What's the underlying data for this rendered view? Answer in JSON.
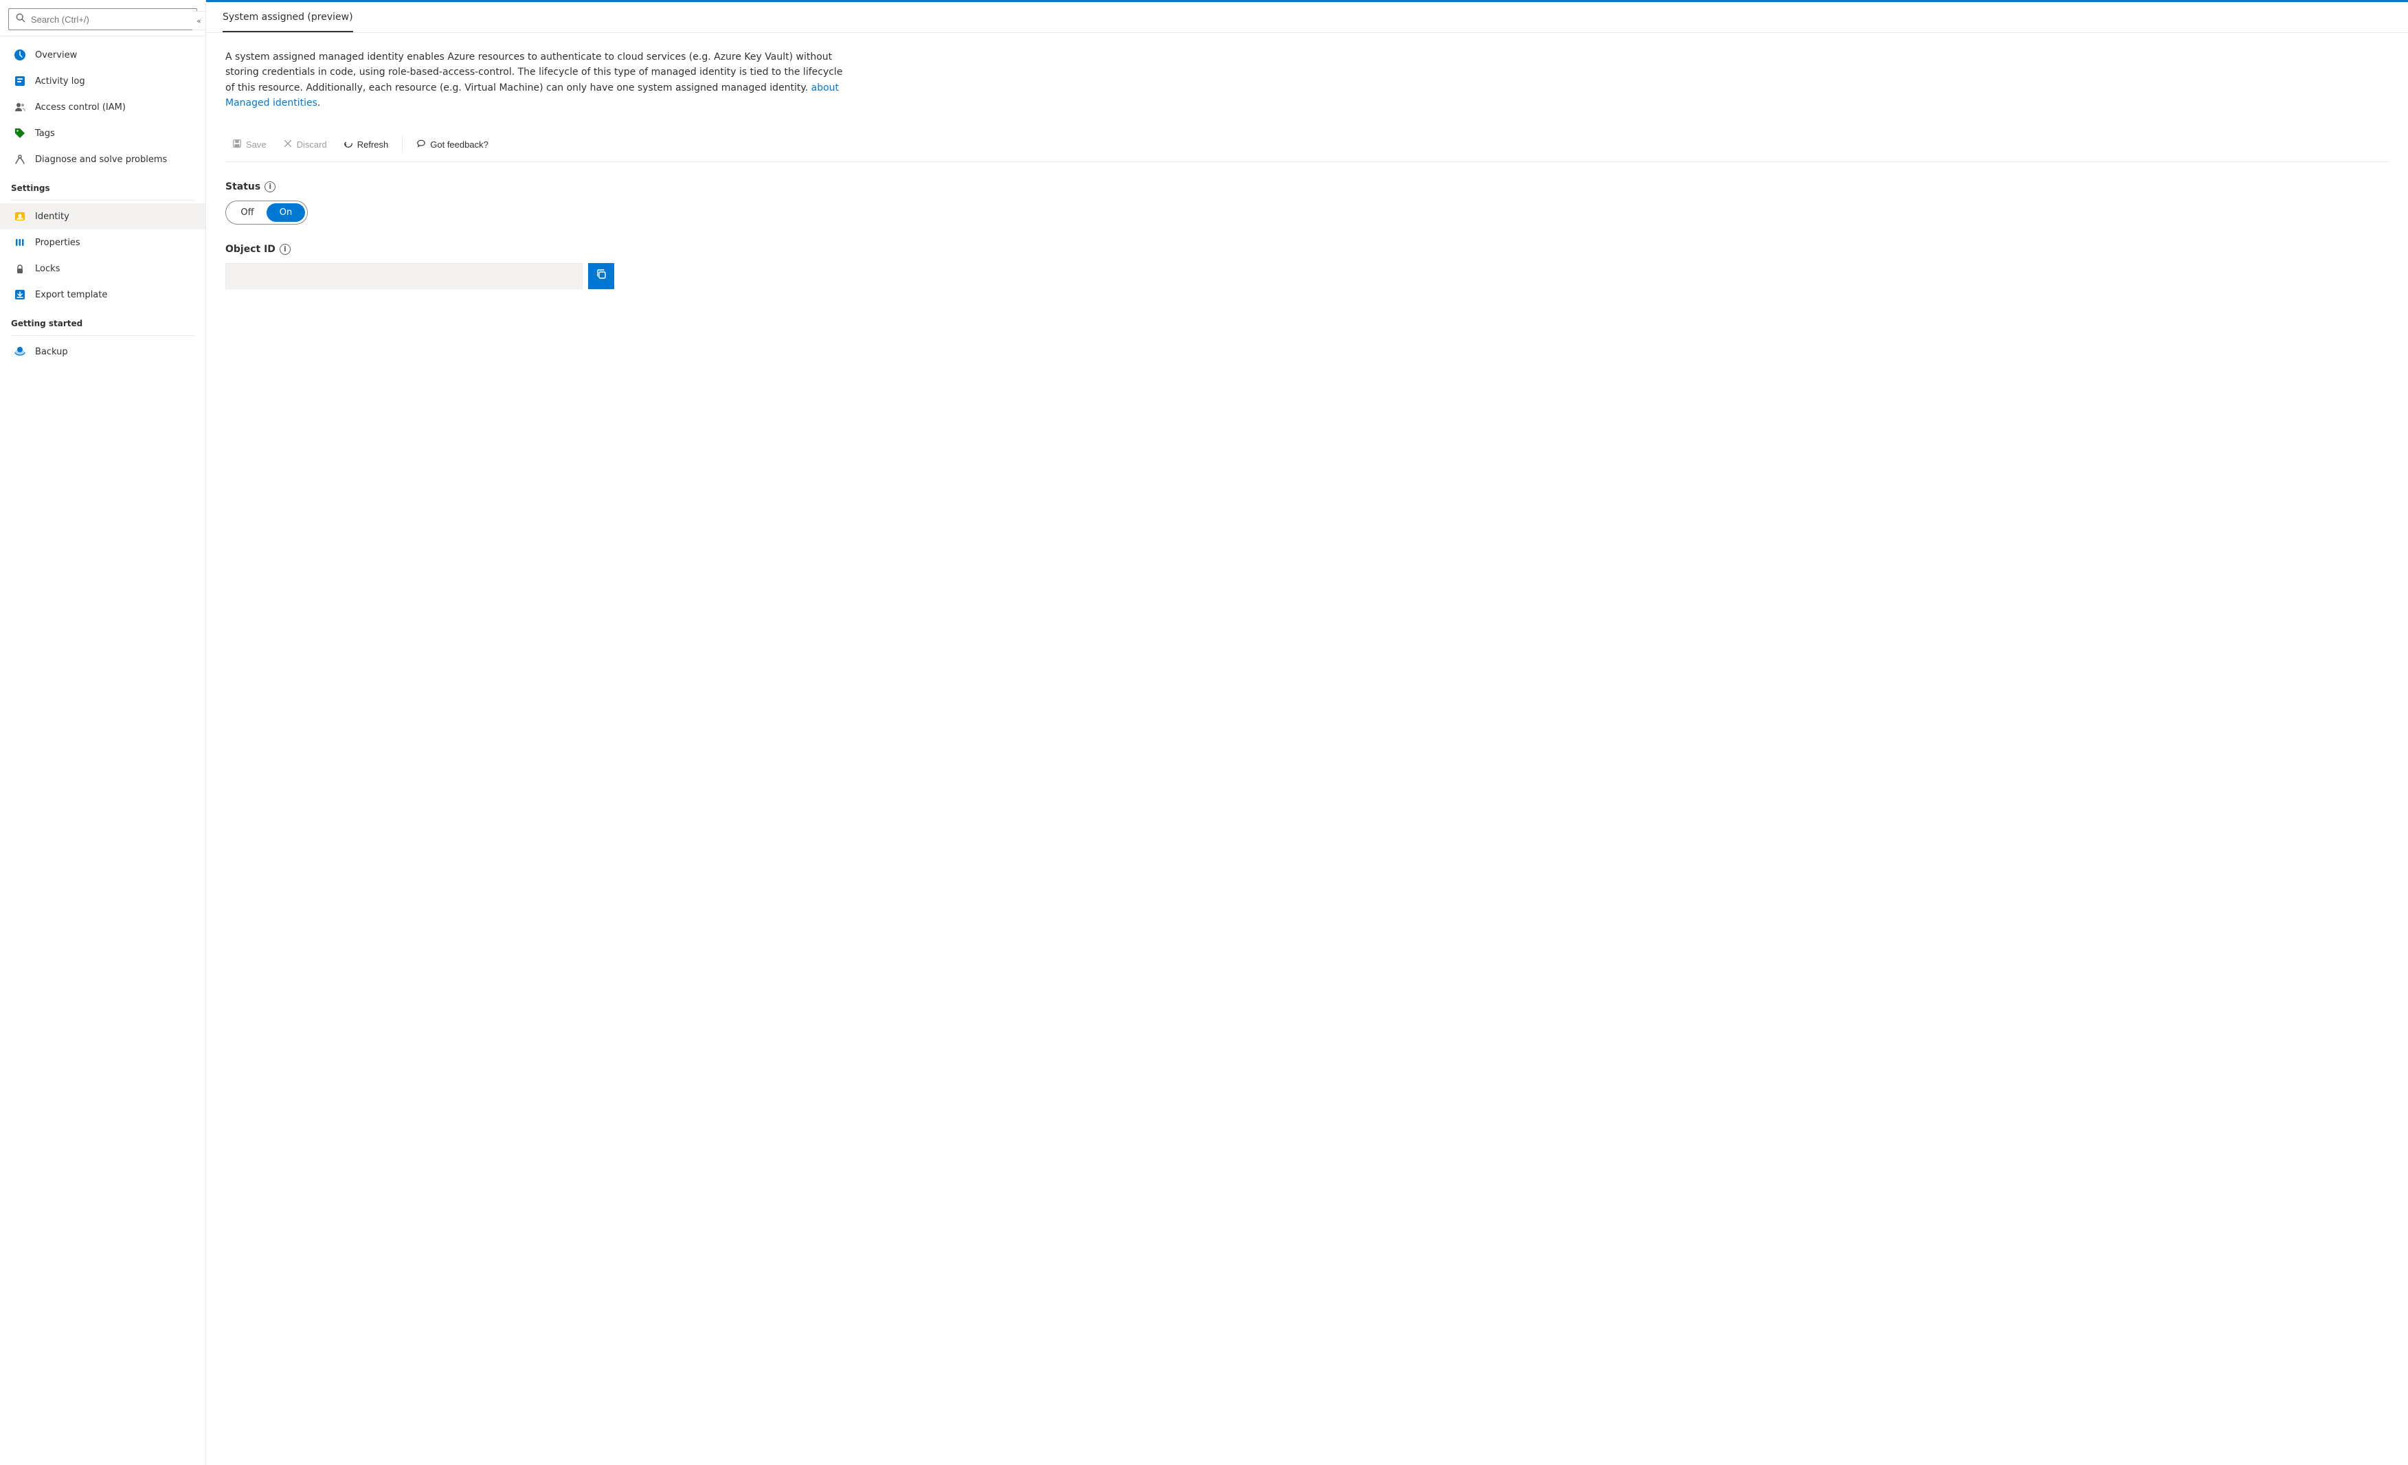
{
  "sidebar": {
    "search_placeholder": "Search (Ctrl+/)",
    "collapse_icon": "«",
    "nav_items": [
      {
        "id": "overview",
        "label": "Overview",
        "icon": "☁",
        "icon_color": "#0078d4",
        "active": false
      },
      {
        "id": "activity-log",
        "label": "Activity log",
        "icon": "📋",
        "icon_color": "#0078d4",
        "active": false
      },
      {
        "id": "access-control",
        "label": "Access control (IAM)",
        "icon": "👥",
        "icon_color": "#605e5c",
        "active": false
      },
      {
        "id": "tags",
        "label": "Tags",
        "icon": "🏷",
        "icon_color": "#107c10",
        "active": false
      },
      {
        "id": "diagnose",
        "label": "Diagnose and solve problems",
        "icon": "🔧",
        "icon_color": "#605e5c",
        "active": false
      }
    ],
    "settings_header": "Settings",
    "settings_items": [
      {
        "id": "identity",
        "label": "Identity",
        "icon": "🔑",
        "icon_color": "#ffb900",
        "active": true
      },
      {
        "id": "properties",
        "label": "Properties",
        "icon": "|||",
        "icon_color": "#0078d4",
        "active": false
      },
      {
        "id": "locks",
        "label": "Locks",
        "icon": "🔒",
        "icon_color": "#605e5c",
        "active": false
      },
      {
        "id": "export-template",
        "label": "Export template",
        "icon": "⬇",
        "icon_color": "#0078d4",
        "active": false
      }
    ],
    "getting_started_header": "Getting started",
    "getting_started_items": [
      {
        "id": "backup",
        "label": "Backup",
        "icon": "☁",
        "icon_color": "#0078d4",
        "active": false
      }
    ]
  },
  "main": {
    "tab_active": "System assigned (preview)",
    "tabs": [
      {
        "id": "system-assigned",
        "label": "System assigned (preview)",
        "active": true
      }
    ],
    "description": "A system assigned managed identity enables Azure resources to authenticate to cloud services (e.g. Azure Key Vault) without storing credentials in code, using role-based-access-control. The lifecycle of this type of managed identity is tied to the lifecycle of this resource. Additionally, each resource (e.g. Virtual Machine) can only have one system assigned managed identity.",
    "description_link_text": "about Managed identities",
    "description_link": "#",
    "toolbar": {
      "save_label": "Save",
      "discard_label": "Discard",
      "refresh_label": "Refresh",
      "feedback_label": "Got feedback?"
    },
    "status_label": "Status",
    "status_toggle_off": "Off",
    "status_toggle_on": "On",
    "status_value": "on",
    "object_id_label": "Object ID",
    "object_id_value": "",
    "copy_icon": "⧉"
  }
}
